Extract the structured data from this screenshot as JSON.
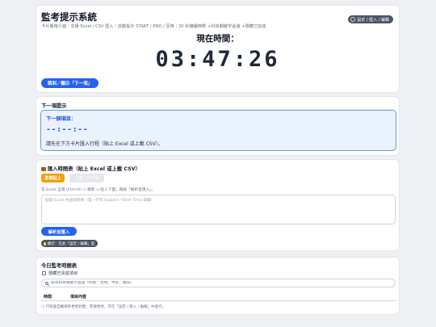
{
  "header": {
    "title": "監考提示系統",
    "subtitle": "卡片風格介面｜支援 Excel / CSV 匯入｜自動提示 START / END / 至時｜30 秒鐘讀倒數 +科目關鍵字過濾 +隱藏已完成",
    "settings_label": "設定 / 匯入 / 編輯",
    "now_label": "現在時間：",
    "clock": "03:47:26",
    "jump_button": "跳到／顯示「下一項」"
  },
  "next_prompt": {
    "section_title": "下一項提示",
    "label": "下一個項目：",
    "time": "--:--:--",
    "message": "請先在下方卡片匯入行程（貼上 Excel 或上載 CSV）。"
  },
  "import": {
    "section_title": "匯入時間表（貼上 Excel 或上載 CSV）",
    "paste_tab": "直接貼上",
    "upload_tab": "上載 CSV 檔",
    "hint": "在 Excel 全選 (Ctrl+A) → 複製 → 貼入下面，再按「解析並匯入」。",
    "textarea_placeholder": "貼點 Excel 內並如結果（第一行有 Subject / Start Time 等欄）",
    "parse_button": "解析並匯入",
    "tip": "顯示：在此「設定 / 編輯」區"
  },
  "schedule": {
    "section_title": "今日監考時間表",
    "hide_completed_label": "隱藏已完成項目",
    "search_placeholder": "搜尋科目關鍵字過濾（例如：生物、中史、體育）",
    "columns": [
      "時間",
      "項目內容"
    ],
    "footnote": "ⓘ 行程會自動每秒更新狀態；若要修改，可在「設定 / 匯入 / 編輯」中進行。"
  },
  "colors": {
    "primary": "#2563eb",
    "accent_orange": "#f59e0b",
    "next_box_bg": "#eaf2fd",
    "next_box_border": "#5b9bd5",
    "dark_pill": "#4b5563"
  },
  "icons": [
    "gear-icon",
    "import-icon",
    "bulb-icon",
    "search-icon",
    "checkbox-icon",
    "info-icon"
  ]
}
